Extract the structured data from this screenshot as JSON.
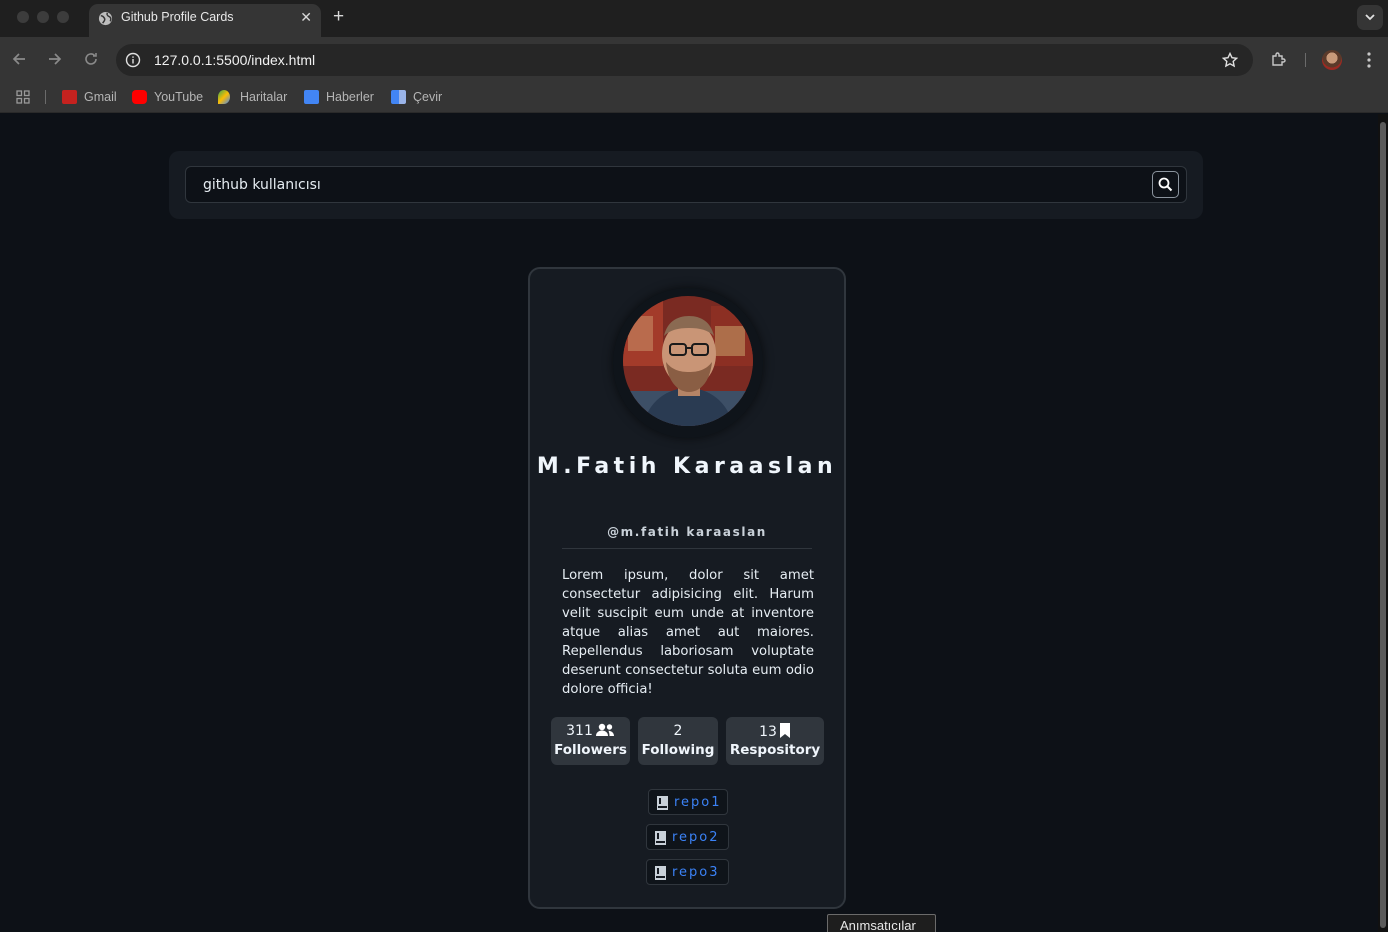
{
  "browser": {
    "tab_title": "Github Profile Cards",
    "new_tab_label": "+",
    "close_label": "✕",
    "url": "127.0.0.1:5500/index.html",
    "bookmarks": [
      {
        "label": "Gmail",
        "icon": "gmail-icon"
      },
      {
        "label": "YouTube",
        "icon": "youtube-icon"
      },
      {
        "label": "Haritalar",
        "icon": "maps-icon"
      },
      {
        "label": "Haberler",
        "icon": "news-icon"
      },
      {
        "label": "Çevir",
        "icon": "translate-icon"
      }
    ]
  },
  "search": {
    "placeholder": "github kullanıcısı",
    "button_icon": "search-icon"
  },
  "profile": {
    "name": "M.Fatih Karaaslan",
    "handle": "@m.fatih karaaslan",
    "bio": "Lorem ipsum, dolor sit amet consectetur adipisicing elit. Harum velit suscipit eum unde at inventore atque alias amet aut maiores. Repellendus laboriosam voluptate deserunt consectetur soluta eum odio dolore officia!",
    "stats": [
      {
        "value": "311",
        "label": "Followers",
        "icon": "users-icon"
      },
      {
        "value": "2",
        "label": "Following",
        "icon": ""
      },
      {
        "value": "13",
        "label": "Respository",
        "icon": "bookmark-icon"
      }
    ],
    "repos": [
      "repo1",
      "repo2",
      "repo3"
    ]
  },
  "tooltip": "Anımsatıcılar",
  "colors": {
    "page_bg": "#0d1117",
    "card_bg": "#161b22",
    "border": "#30363d",
    "repo_link": "#3b82f6",
    "text": "#f0f6fc"
  }
}
